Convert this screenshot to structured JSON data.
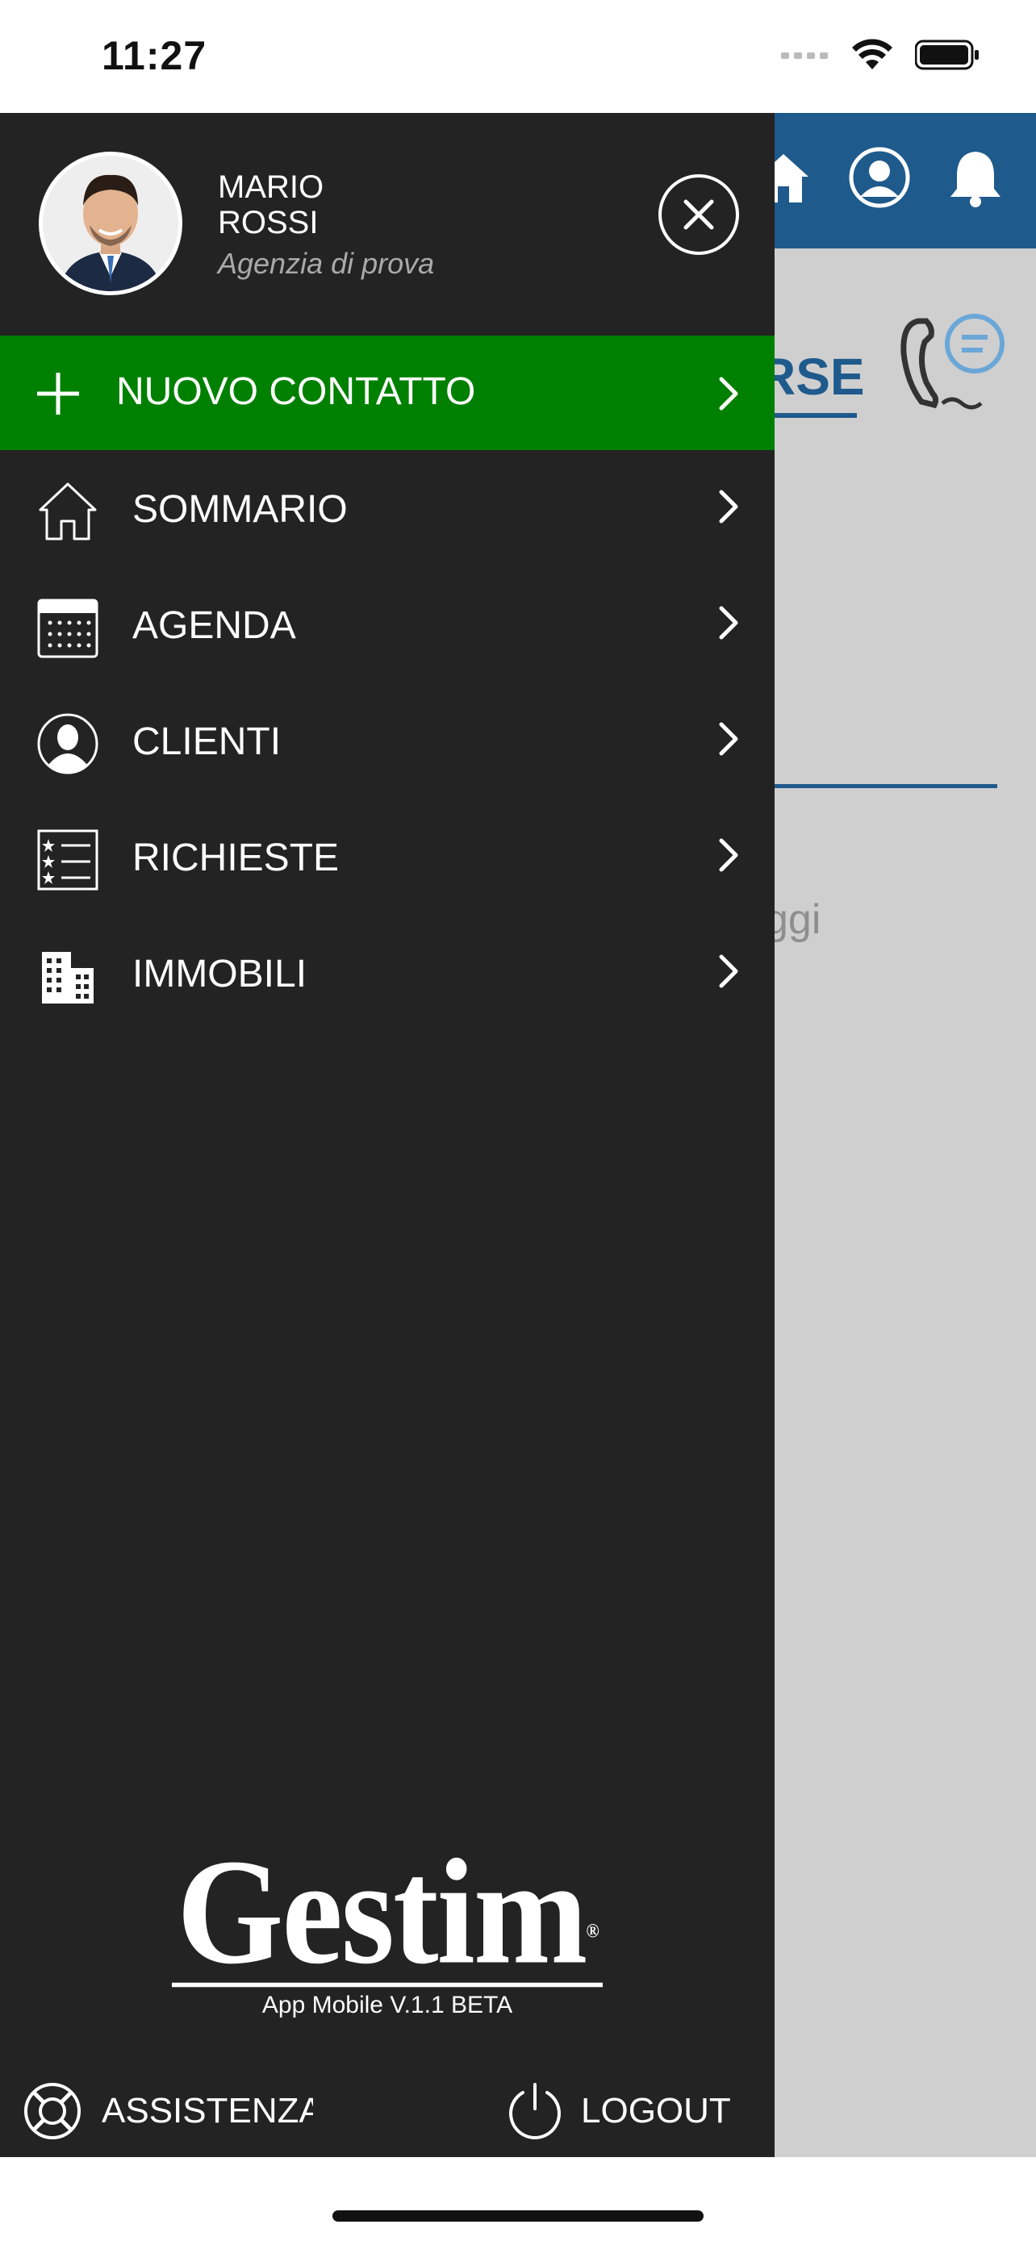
{
  "status_bar": {
    "time": "11:27",
    "icons": [
      "cellular-icon",
      "wifi-icon",
      "battery-icon"
    ]
  },
  "background": {
    "tab_fragment": "RSE",
    "text_fragment": "ggi",
    "header_icons": [
      "home-icon",
      "profile-icon",
      "bell-icon"
    ]
  },
  "drawer": {
    "user": {
      "first_name": "MARIO",
      "last_name": "ROSSI",
      "agency": "Agenzia di prova"
    },
    "new_contact_label": "NUOVO CONTATTO",
    "menu": [
      {
        "label": "SOMMARIO",
        "icon": "home-outline-icon"
      },
      {
        "label": "AGENDA",
        "icon": "calendar-icon"
      },
      {
        "label": "CLIENTI",
        "icon": "client-avatar-icon"
      },
      {
        "label": "RICHIESTE",
        "icon": "star-list-icon"
      },
      {
        "label": "IMMOBILI",
        "icon": "building-icon"
      }
    ],
    "brand": {
      "logo_text": "Gestim",
      "version": "App Mobile V.1.1 BETA"
    },
    "footer": {
      "assist_label": "ASSISTENZA",
      "logout_label": "LOGOUT"
    }
  },
  "colors": {
    "drawer_bg": "#232323",
    "accent_green": "#008000",
    "brand_blue": "#1f5a8c",
    "overlay_gray": "#cfcfcf"
  }
}
